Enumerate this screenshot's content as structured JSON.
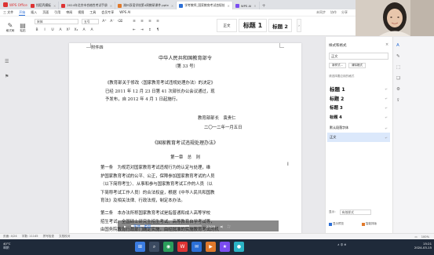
{
  "tabs": {
    "home": "WPS Office",
    "items": [
      {
        "label": "找稻壳模板",
        "color": "#d33"
      },
      {
        "label": "2024年北京市合格性考试手册",
        "color": "#d33"
      },
      {
        "label": "湖州双语学校第4周教研课件.pptx",
        "color": "#e0792b"
      },
      {
        "label": "学考教师_国家教育考试违规处",
        "color": "#2b6fd6",
        "active": true
      },
      {
        "label": "WPS AI",
        "color": "#7a4cf0"
      }
    ]
  },
  "menu": {
    "items": [
      "三 文件",
      "开始",
      "插入",
      "页面",
      "引用",
      "审阅",
      "视图",
      "工具",
      "会员专享",
      "WPS AI"
    ],
    "active_index": 1,
    "right": [
      "未同步",
      "协作",
      "分享"
    ]
  },
  "ribbon": {
    "big_buttons": [
      "格式刷",
      "粘贴"
    ],
    "font_name": "宋体",
    "font_size": "五号",
    "format_row": [
      "B",
      "I",
      "U",
      "A",
      "X²",
      "X₂",
      "A",
      "A"
    ],
    "para_row": [
      "≡",
      "≡",
      "≡",
      "≡",
      "⇤",
      "⇥",
      "↕",
      "¶"
    ],
    "styles": {
      "body": "正文",
      "h1": "标题 1",
      "h2": "标题 2"
    },
    "more": "›"
  },
  "doc": {
    "appendix": "附件四",
    "header_title": "中华人民共和国教育部令",
    "order_no": "（第 33 号）",
    "decree_lines": [
      "《教育部关于修改〈国家教育考试违规处理办法〉的决定》",
      "已经 2011 年 12 月 23 日第 41 次部长办公会议通过，现",
      "予发布，自 2012 年 4 月 1 日起施行。"
    ],
    "signer": "教育部部长　袁贵仁",
    "date": "二〇一二年一月五日",
    "regulation_title": "《国家教育考试违规处理办法》",
    "chapter": "第一章　总　则",
    "article1": [
      "第一条　为规范对国家教育考试违规行为的认定与处理，维",
      "护国家教育考试的公平、公正，保障参加国家教育考试的人员",
      "（以下简称考生）、从事和参与国家教育考试工作的人员（以",
      "下简称考试工作人员）的合法权益，根据《中华人民共和国教",
      "育法》及相关法律、行政法规，制定本办法。"
    ],
    "article2": [
      "第二条　本办法所称国家教育考试是指普通和成人高等学校",
      "招生考试、全国硕士研究生招生考试、高等教育自学考试等，",
      "由国务院教育行政部门确定实施，由经批准的实施教育考试的机",
      "构承办，面向社会公开、统一举行，其结果作为招收学历教育"
    ]
  },
  "style_pane": {
    "title": "样式和格式",
    "close": "×",
    "current": "正文",
    "buttons": [
      "新样式...",
      "清除格式"
    ],
    "hint": "请选择要应用的格式",
    "items": [
      {
        "label": "标题 1",
        "weight": "bold",
        "size": "6.5px"
      },
      {
        "label": "标题 2",
        "weight": "bold",
        "size": "6px"
      },
      {
        "label": "标题 3",
        "weight": "bold",
        "size": "5.5px"
      },
      {
        "label": "标题 4",
        "weight": "bold",
        "size": "5.2px"
      },
      {
        "label": "默认段落字体",
        "weight": "normal",
        "size": "4px"
      },
      {
        "label": "正文",
        "weight": "normal",
        "size": "4.2px",
        "selected": true
      }
    ],
    "return_mark": "↵",
    "show_label": "显示：",
    "show_value": "有效样式",
    "checks": [
      "显示预览",
      "智能排版"
    ]
  },
  "status": {
    "left": [
      "页面: 4/24",
      "字数: 11145",
      "拼写检查",
      "文档校对"
    ],
    "right": [
      "100%"
    ]
  },
  "video": {
    "play": "▶",
    "time": "23/28",
    "progress": 0.82
  },
  "subtitle": "字体、类型",
  "taskbar": {
    "weather_temp": "40°C",
    "weather_desc": "晴朗",
    "icons": [
      {
        "glyph": "⊞",
        "color": "#3a7be0"
      },
      {
        "glyph": "⌕",
        "color": "#3b4a60"
      },
      {
        "glyph": "◉",
        "color": "#2b9d5b"
      },
      {
        "glyph": "W",
        "color": "#d33"
      },
      {
        "glyph": "✉",
        "color": "#2b6fd6"
      },
      {
        "glyph": "▶",
        "color": "#e0792b"
      },
      {
        "glyph": "★",
        "color": "#7a4cf0"
      },
      {
        "glyph": "●",
        "color": "#2bb3c4"
      }
    ],
    "tray": "∧ 中 ⊕",
    "time": "15:21",
    "date": "2024-03-15"
  }
}
